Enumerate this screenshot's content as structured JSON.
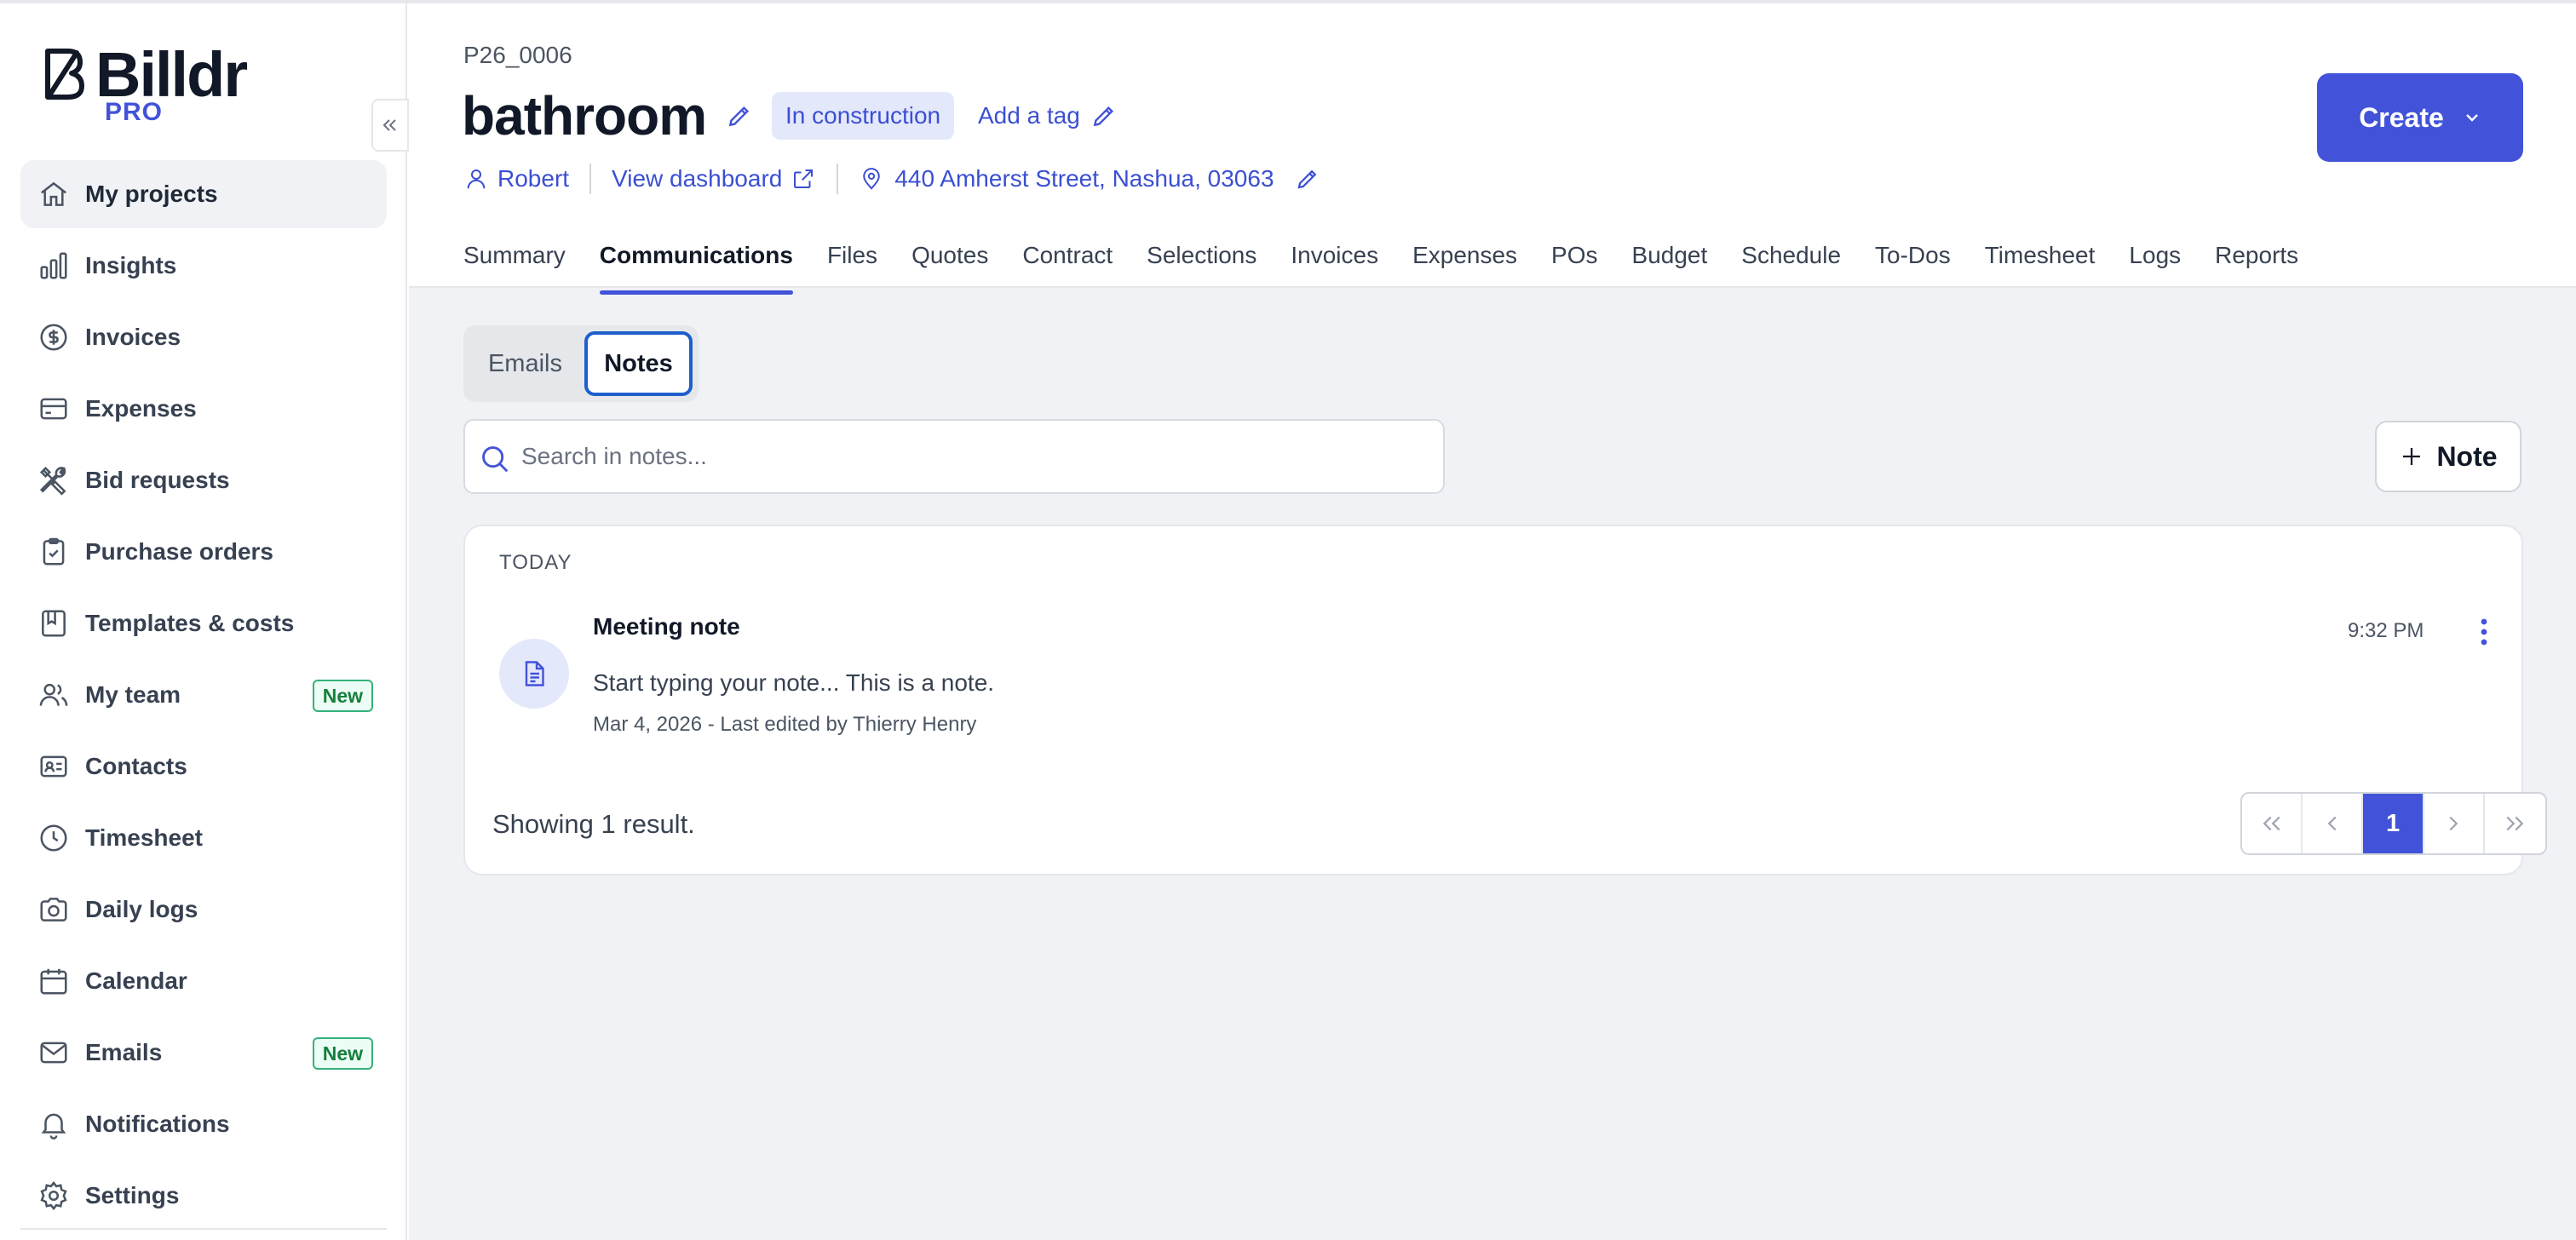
{
  "brand": {
    "name": "Billdr",
    "tier": "PRO"
  },
  "sidebar": {
    "items": [
      {
        "label": "My projects",
        "icon": "home-icon"
      },
      {
        "label": "Insights",
        "icon": "bar-chart-icon"
      },
      {
        "label": "Invoices",
        "icon": "dollar-circle-icon"
      },
      {
        "label": "Expenses",
        "icon": "credit-card-icon"
      },
      {
        "label": "Bid requests",
        "icon": "tools-icon"
      },
      {
        "label": "Purchase orders",
        "icon": "clipboard-check-icon"
      },
      {
        "label": "Templates & costs",
        "icon": "book-icon"
      },
      {
        "label": "My team",
        "icon": "users-icon",
        "badge": "New"
      },
      {
        "label": "Contacts",
        "icon": "contact-card-icon"
      },
      {
        "label": "Timesheet",
        "icon": "clock-icon"
      },
      {
        "label": "Daily logs",
        "icon": "camera-icon"
      },
      {
        "label": "Calendar",
        "icon": "calendar-icon"
      },
      {
        "label": "Emails",
        "icon": "mail-icon",
        "badge": "New"
      },
      {
        "label": "Notifications",
        "icon": "bell-icon"
      },
      {
        "label": "Settings",
        "icon": "gear-icon"
      }
    ]
  },
  "project": {
    "code": "P26_0006",
    "title": "bathroom",
    "status": "In construction",
    "add_tag": "Add a tag",
    "owner": "Robert",
    "dashboard_link": "View dashboard",
    "address": "440 Amherst Street, Nashua, 03063"
  },
  "header": {
    "create_label": "Create"
  },
  "tabs": [
    {
      "label": "Summary"
    },
    {
      "label": "Communications",
      "active": true
    },
    {
      "label": "Files"
    },
    {
      "label": "Quotes"
    },
    {
      "label": "Contract"
    },
    {
      "label": "Selections"
    },
    {
      "label": "Invoices"
    },
    {
      "label": "Expenses"
    },
    {
      "label": "POs"
    },
    {
      "label": "Budget"
    },
    {
      "label": "Schedule"
    },
    {
      "label": "To-Dos"
    },
    {
      "label": "Timesheet"
    },
    {
      "label": "Logs"
    },
    {
      "label": "Reports"
    }
  ],
  "comm": {
    "segments": {
      "emails": "Emails",
      "notes": "Notes",
      "selected": "Notes"
    },
    "search_placeholder": "Search in notes...",
    "add_note_label": "Note"
  },
  "notes": {
    "group_label": "TODAY",
    "items": [
      {
        "title": "Meeting note",
        "body": "Start typing your note... This is a note.",
        "meta": "Mar 4, 2026 - Last edited by Thierry Henry",
        "time": "9:32 PM"
      }
    ],
    "showing": "Showing 1 result."
  },
  "pagination": {
    "current_page": "1"
  },
  "colors": {
    "accent": "#4253d9",
    "badge_green": "#15803d",
    "status_bg": "#e4e8fb"
  }
}
